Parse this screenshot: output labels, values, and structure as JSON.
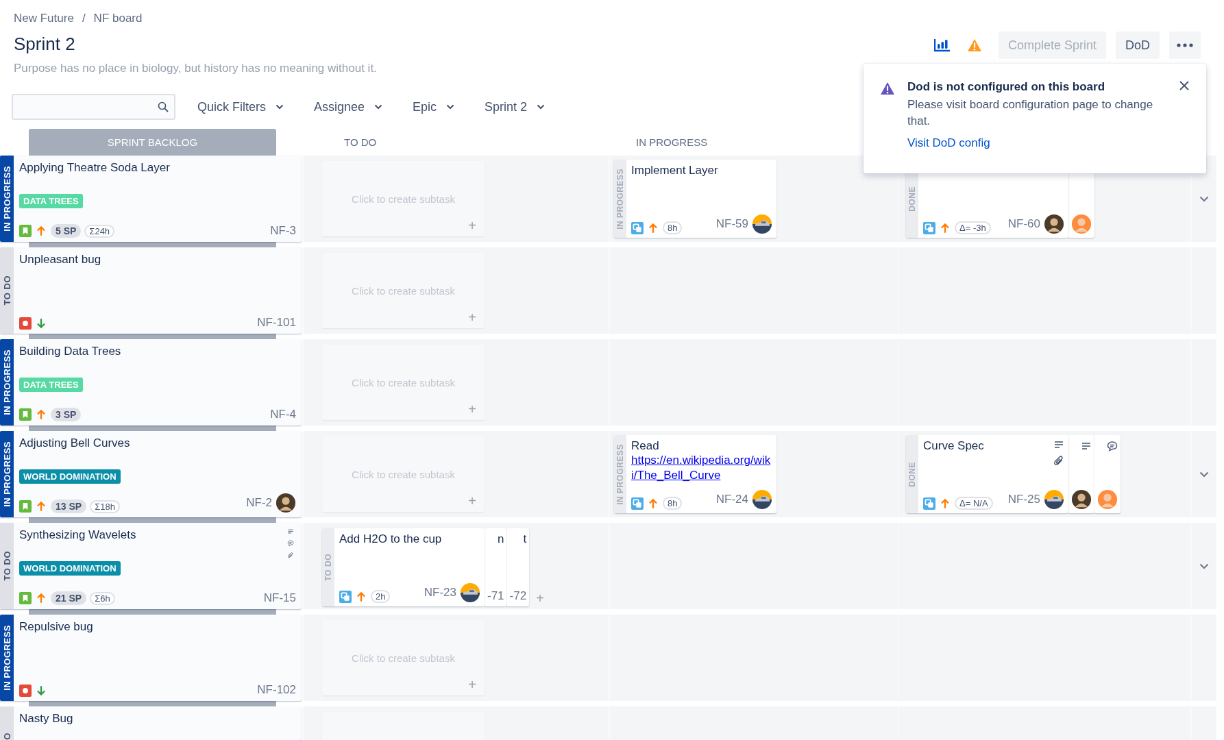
{
  "breadcrumbs": [
    "New Future",
    "NF board"
  ],
  "breadcrumb_separator": "/",
  "title": "Sprint 2",
  "subtitle": "Purpose has no place in biology, but history has no meaning without it.",
  "actions": {
    "complete": {
      "label": "Complete Sprint",
      "disabled": true
    },
    "dod": "DoD"
  },
  "filters": [
    "Quick Filters",
    "Assignee",
    "Epic",
    "Sprint 2"
  ],
  "columns": [
    {
      "label": "SPRINT BACKLOG",
      "kind": "backlog"
    },
    {
      "label": "TO DO",
      "kind": "plain"
    },
    {
      "label": "IN PROGRESS",
      "kind": "plain"
    }
  ],
  "notification": {
    "title": "Dod is not configured on this board",
    "message": "Please visit board configuration page to change that.",
    "link": "Visit DoD config"
  },
  "rows": [
    {
      "status": {
        "label": "IN PROGRESS",
        "kind": "inprogress"
      },
      "title": "Applying Theatre Soda Layer",
      "epic": {
        "label": "DATA TREES",
        "color": "#57d9a3"
      },
      "issue_type": {
        "kind": "story"
      },
      "priority": {
        "kind": "high"
      },
      "points": "5 SP",
      "estimate": "Σ24h",
      "key": "NF-3",
      "todo": {
        "kind": "placeholder",
        "text": "Click to create subtask",
        "plus": "+"
      },
      "in_progress": {
        "status": "IN PROGRESS",
        "title": "Implement Layer",
        "estimate": "8h",
        "key": "NF-59",
        "avatars": [
          {
            "kind": "car"
          }
        ]
      },
      "done": {
        "status": "DONE",
        "estimate": "Δ= -3h",
        "key": "NF-60",
        "avatars": [
          {
            "kind": "person-brown"
          }
        ],
        "behind": [
          {
            "avatars": [
              {
                "kind": "person-orange"
              }
            ]
          }
        ]
      },
      "collapsible": true
    },
    {
      "status": {
        "label": "TO DO",
        "kind": "todo"
      },
      "title": "Unpleasant bug",
      "issue_type": {
        "kind": "bug"
      },
      "priority": {
        "kind": "low"
      },
      "key": "NF-101",
      "todo": {
        "kind": "placeholder",
        "text": "Click to create subtask",
        "plus": "+"
      }
    },
    {
      "status": {
        "label": "IN PROGRESS",
        "kind": "inprogress"
      },
      "title": "Building Data Trees",
      "epic": {
        "label": "DATA TREES",
        "color": "#57d9a3"
      },
      "issue_type": {
        "kind": "story"
      },
      "priority": {
        "kind": "high"
      },
      "points": "3 SP",
      "key": "NF-4",
      "todo": {
        "kind": "placeholder",
        "text": "Click to create subtask",
        "plus": "+"
      }
    },
    {
      "status": {
        "label": "IN PROGRESS",
        "kind": "inprogress"
      },
      "title": "Adjusting Bell Curves",
      "epic": {
        "label": "WORLD DOMINATION",
        "color": "#0b8fa8"
      },
      "issue_type": {
        "kind": "story"
      },
      "priority": {
        "kind": "high"
      },
      "points": "13 SP",
      "estimate": "Σ18h",
      "key": "NF-2",
      "avatars": [
        {
          "kind": "person-brown"
        }
      ],
      "todo": {
        "kind": "placeholder",
        "text": "Click to create subtask",
        "plus": "+"
      },
      "in_progress": {
        "status": "IN PROGRESS",
        "title": "Read",
        "link": "https://en.wikipedia.org/wiki/The_Bell_Curve",
        "estimate": "8h",
        "key": "NF-24",
        "avatars": [
          {
            "kind": "car"
          }
        ]
      },
      "done": {
        "status": "DONE",
        "title": "Curve Spec",
        "icons": [
          {
            "kind": "description"
          },
          {
            "kind": "attachment"
          }
        ],
        "estimate": "Δ= N/A",
        "key": "NF-25",
        "avatars": [
          {
            "kind": "car"
          }
        ],
        "behind": [
          {
            "icons": [
              {
                "kind": "description"
              }
            ],
            "avatars": [
              {
                "kind": "person-brown"
              }
            ]
          },
          {
            "icons": [
              {
                "kind": "comment"
              }
            ],
            "avatars": [
              {
                "kind": "person-orange"
              }
            ]
          }
        ]
      },
      "collapsible": true
    },
    {
      "status": {
        "label": "TO DO",
        "kind": "todo"
      },
      "title": "Synthesizing Wavelets",
      "icons": [
        {
          "kind": "description"
        },
        {
          "kind": "comment"
        },
        {
          "kind": "attachment"
        }
      ],
      "epic": {
        "label": "WORLD DOMINATION",
        "color": "#0b8fa8"
      },
      "issue_type": {
        "kind": "story"
      },
      "priority": {
        "kind": "high"
      },
      "points": "21 SP",
      "estimate": "Σ6h",
      "key": "NF-15",
      "todo": {
        "kind": "subtasks",
        "card": {
          "status": "TO DO",
          "title": "Add H2O to the cup",
          "estimate": "2h",
          "key": "NF-23",
          "avatars": [
            {
              "kind": "car"
            }
          ],
          "behind": [
            {
              "title": "n",
              "key": "-71"
            },
            {
              "title": "t",
              "key": "-72"
            }
          ]
        },
        "plus": "+"
      },
      "collapsible": true
    },
    {
      "status": {
        "label": "IN PROGRESS",
        "kind": "inprogress"
      },
      "title": "Repulsive bug",
      "issue_type": {
        "kind": "bug"
      },
      "priority": {
        "kind": "low"
      },
      "key": "NF-102",
      "todo": {
        "kind": "placeholder",
        "text": "Click to create subtask",
        "plus": "+"
      }
    },
    {
      "status": {
        "label": "O",
        "kind": "todo"
      },
      "title": "Nasty Bug",
      "todo": {
        "kind": "blank"
      }
    }
  ]
}
